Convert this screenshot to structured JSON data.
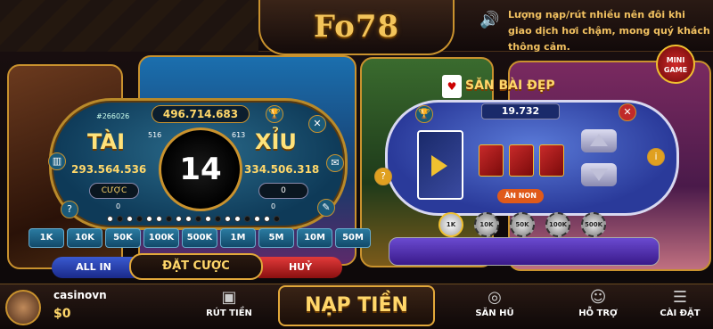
{
  "header": {
    "logo": "Fo78",
    "notice": "Lượng nạp/rút nhiều nên đôi khi giao dịch hơi chậm, mong quý khách thông cảm."
  },
  "taixiu": {
    "session": "#266026",
    "jackpot": "496.714.683",
    "tai_label": "TÀI",
    "xiu_label": "XỈU",
    "tai_total": "293.564.536",
    "xiu_total": "334.506.318",
    "tai_players": "516",
    "xiu_players": "613",
    "countdown": "14",
    "tai_bet_label": "CƯỢC",
    "xiu_bet_value": "0",
    "tai_my_bet": "0",
    "xiu_my_bet": "0",
    "chips": [
      "1K",
      "10K",
      "50K",
      "100K",
      "500K",
      "1M",
      "5M",
      "10M",
      "50M"
    ],
    "allin_label": "ALL IN",
    "place_bet_label": "ĐẶT CƯỢC",
    "cancel_label": "HUỶ"
  },
  "sanbai": {
    "title": "SĂN BÀI ĐẸP",
    "value": "19.732",
    "auto_label": "ĂN NON",
    "chips": [
      "1K",
      "10K",
      "50K",
      "100K",
      "500K"
    ]
  },
  "minigame": {
    "label_line1": "MINI",
    "label_line2": "GAME"
  },
  "user": {
    "name": "casinovn",
    "balance": "$0"
  },
  "bottom_nav": {
    "withdraw": "RÚT TIỀN",
    "deposit": "NẠP TIỀN",
    "jackpot": "SĂN HŨ",
    "support": "HỖ TRỢ",
    "settings": "CÀI ĐẶT"
  },
  "colors": {
    "gold": "#ffd76a",
    "border_gold": "#c9922e",
    "cancel_red": "#e23a3a",
    "allin_blue": "#3a5ad0"
  }
}
